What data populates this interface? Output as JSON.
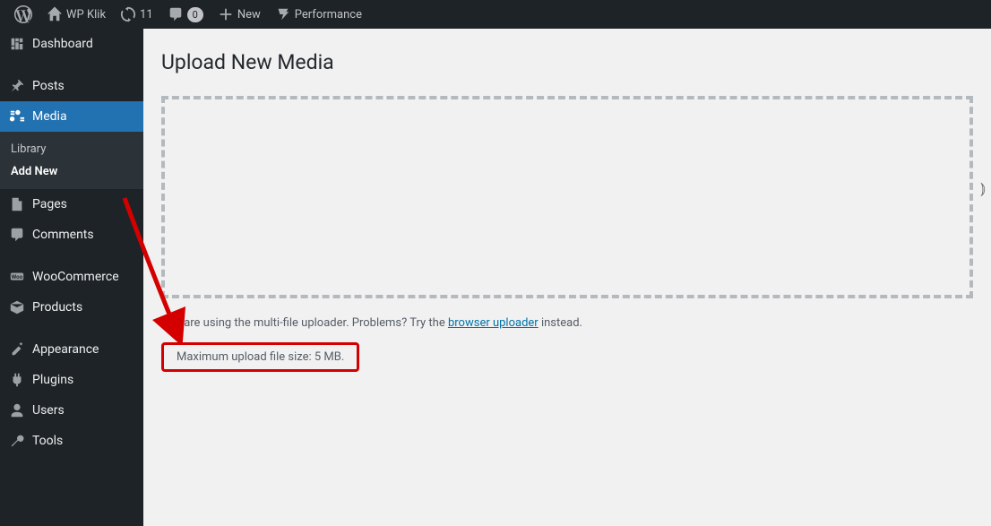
{
  "adminbar": {
    "site_name": "WP Klik",
    "updates": "11",
    "comments": "0",
    "new_label": "New",
    "performance_label": "Performance"
  },
  "sidebar": {
    "dashboard": "Dashboard",
    "posts": "Posts",
    "media": "Media",
    "media_sub": {
      "library": "Library",
      "addnew": "Add New"
    },
    "pages": "Pages",
    "comments": "Comments",
    "woocommerce": "WooCommerce",
    "products": "Products",
    "appearance": "Appearance",
    "plugins": "Plugins",
    "users": "Users",
    "tools": "Tools"
  },
  "page": {
    "title": "Upload New Media",
    "hint_prefix": "You are using the multi-file uploader. Problems? Try the ",
    "hint_link": "browser uploader",
    "hint_suffix": " instead.",
    "max_size": "Maximum upload file size: 5 MB."
  }
}
